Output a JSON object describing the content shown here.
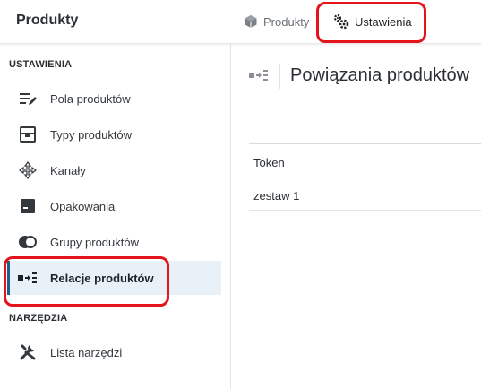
{
  "header": {
    "app_title": "Produkty",
    "tabs": [
      {
        "label": "Produkty",
        "icon": "cube-icon"
      },
      {
        "label": "Ustawienia",
        "icon": "gears-icon"
      }
    ]
  },
  "sidebar": {
    "sections": [
      {
        "title": "USTAWIENIA",
        "items": [
          {
            "label": "Pola produktów",
            "icon": "edit-list-icon"
          },
          {
            "label": "Typy produktów",
            "icon": "box-type-icon"
          },
          {
            "label": "Kanały",
            "icon": "arrows-move-icon"
          },
          {
            "label": "Opakowania",
            "icon": "package-icon"
          },
          {
            "label": "Grupy produktów",
            "icon": "circles-icon"
          },
          {
            "label": "Relacje produktów",
            "icon": "relations-icon",
            "active": true
          }
        ]
      },
      {
        "title": "NARZĘDZIA",
        "items": [
          {
            "label": "Lista narzędzi",
            "icon": "tools-icon"
          }
        ]
      }
    ]
  },
  "main": {
    "title": "Powiązania produktów",
    "table": {
      "columns": [
        "Token"
      ],
      "rows": [
        [
          "zestaw 1"
        ]
      ]
    }
  },
  "colors": {
    "accent": "#1f5f8b",
    "active_bg": "#e8f1f8",
    "annotation_red": "#e3141b"
  }
}
